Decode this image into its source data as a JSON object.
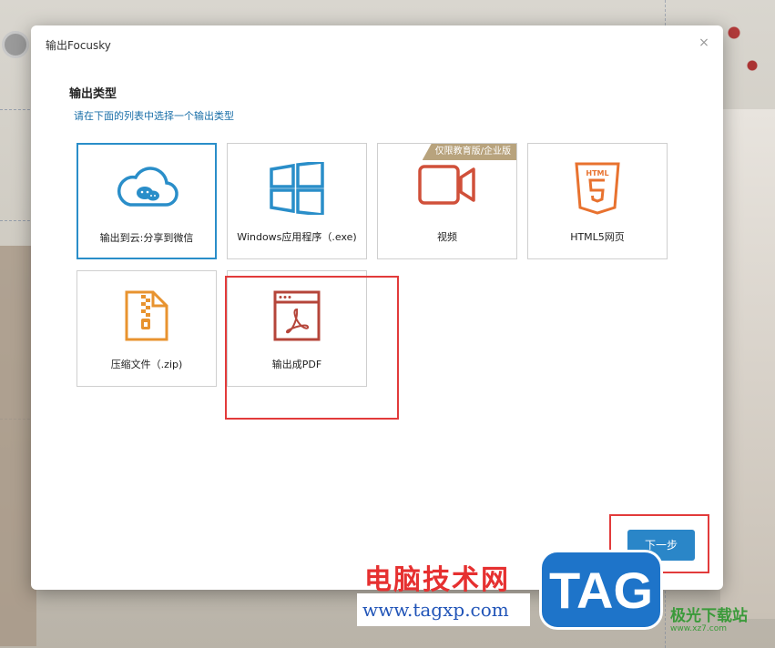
{
  "dialog": {
    "title": "输出Focusky",
    "close_label": "×",
    "section_title": "输出类型",
    "section_subtitle": "请在下面的列表中选择一个输出类型",
    "next_label": "下一步"
  },
  "tiles": [
    {
      "label": "输出到云:分享到微信",
      "icon": "cloud-wechat-icon",
      "selected": true
    },
    {
      "label": "Windows应用程序（.exe)",
      "icon": "windows-icon"
    },
    {
      "label": "视频",
      "icon": "video-camera-icon",
      "ribbon": "仅限教育版/企业版"
    },
    {
      "label": "HTML5网页",
      "icon": "html5-icon"
    },
    {
      "label": "压缩文件（.zip)",
      "icon": "zip-file-icon"
    },
    {
      "label": "输出成PDF",
      "icon": "pdf-icon"
    }
  ],
  "colors": {
    "accent": "#2a86c8",
    "highlight": "#e23b3b",
    "windows_blue": "#2a8ec9",
    "video_red": "#d0503a",
    "html5_orange": "#e8722f",
    "zip_orange": "#e8932f",
    "pdf_red": "#b5453a"
  },
  "watermark": {
    "site_name": "电脑技术网",
    "url": "www.tagxp.com",
    "tag": "TAG",
    "side_text": "极光下载站",
    "side_sub": "www.xz7.com"
  }
}
